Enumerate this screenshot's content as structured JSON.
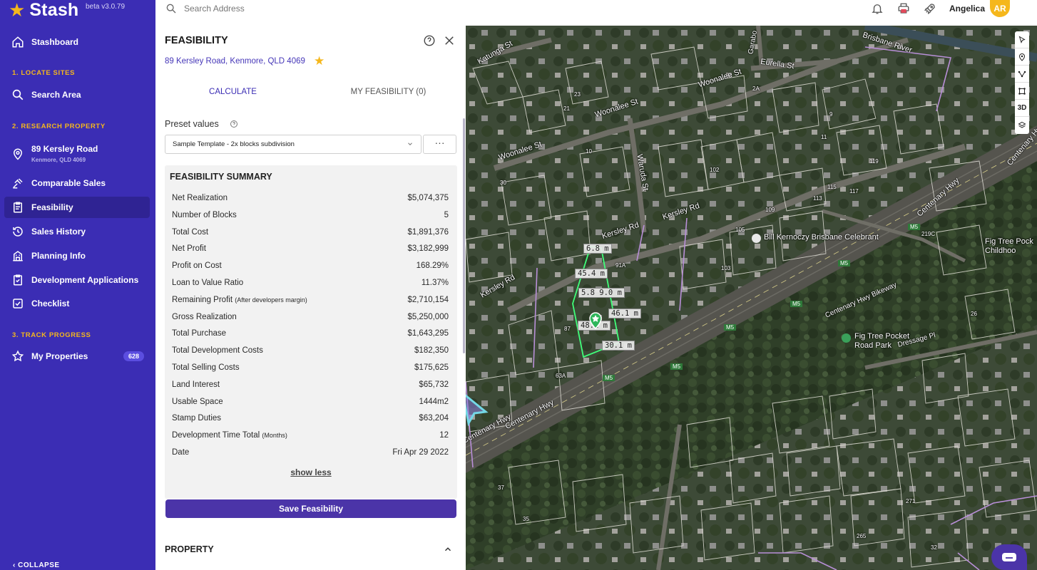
{
  "app": {
    "name": "Stash",
    "version": "beta v3.0.79"
  },
  "sidebar": {
    "items": [
      {
        "label": "Stashboard",
        "icon": "home-icon"
      },
      {
        "label": "Search Area",
        "icon": "search-icon"
      },
      {
        "label": "89 Kersley Road",
        "sublabel": "Kenmore, QLD 4069",
        "icon": "location-pin-icon"
      },
      {
        "label": "Comparable Sales",
        "icon": "gavel-icon"
      },
      {
        "label": "Feasibility",
        "icon": "clipboard-icon",
        "active": true
      },
      {
        "label": "Sales History",
        "icon": "history-icon"
      },
      {
        "label": "Planning Info",
        "icon": "building-icon"
      },
      {
        "label": "Development Applications",
        "icon": "clipboard-check-icon"
      },
      {
        "label": "Checklist",
        "icon": "checkbox-icon"
      },
      {
        "label": "My Properties",
        "icon": "star-outline-icon",
        "badge": "628"
      }
    ],
    "sections": [
      "1. LOCATE SITES",
      "2. RESEARCH PROPERTY",
      "3. TRACK PROGRESS"
    ],
    "collapse_label": "COLLAPSE"
  },
  "topbar": {
    "search_placeholder": "Search Address",
    "user_name": "Angelica",
    "avatar_initials": "AR"
  },
  "panel": {
    "title": "FEASIBILITY",
    "address": "89 Kersley Road, Kenmore, QLD 4069",
    "tabs": [
      "CALCULATE",
      "MY FEASIBILITY (0)"
    ],
    "preset_label": "Preset values",
    "preset_selected": "Sample Template - 2x blocks subdivision",
    "more_label": "···",
    "summary_title": "FEASIBILITY SUMMARY",
    "rows": [
      {
        "label": "Net Realization",
        "note": "",
        "value": "$5,074,375"
      },
      {
        "label": "Number of Blocks",
        "note": "",
        "value": "5"
      },
      {
        "label": "Total Cost",
        "note": "",
        "value": "$1,891,376"
      },
      {
        "label": "Net Profit",
        "note": "",
        "value": "$3,182,999"
      },
      {
        "label": "Profit on Cost",
        "note": "",
        "value": "168.29%"
      },
      {
        "label": "Loan to Value Ratio",
        "note": "",
        "value": "11.37%"
      },
      {
        "label": "Remaining Profit",
        "note": "(After developers margin)",
        "value": "$2,710,154"
      },
      {
        "label": "Gross Realization",
        "note": "",
        "value": "$5,250,000"
      },
      {
        "label": "Total Purchase",
        "note": "",
        "value": "$1,643,295"
      },
      {
        "label": "Total Development Costs",
        "note": "",
        "value": "$182,350"
      },
      {
        "label": "Total Selling Costs",
        "note": "",
        "value": "$175,625"
      },
      {
        "label": "Land Interest",
        "note": "",
        "value": "$65,732"
      },
      {
        "label": "Usable Space",
        "note": "",
        "value": "1444m2"
      },
      {
        "label": "Stamp Duties",
        "note": "",
        "value": "$63,204"
      },
      {
        "label": "Development Time Total",
        "note": "(Months)",
        "value": "12"
      },
      {
        "label": "Date",
        "note": "",
        "value": "Fri Apr 29 2022"
      }
    ],
    "show_less": "show less",
    "save_button": "Save Feasibility",
    "property_section": "PROPERTY"
  },
  "map": {
    "tool_3d": "3D",
    "streets": [
      "Katunga St",
      "Woonalee St",
      "Woonalee St",
      "Woonalee St",
      "Eurella St",
      "Waruda St",
      "Kersley Rd",
      "Kersley Rd",
      "Kersley Rd",
      "Centenary Hwy",
      "Centenary Hwy",
      "Centenary Hwy",
      "Centenary Hwy Bikeway",
      "Dressage Pl",
      "Brisbane River",
      "Garabo"
    ],
    "places": [
      "Bill Kernoczy Brisbane Celebrant",
      "Fig Tree Pocket Road Park",
      "Fig Tree Pock Childhoo"
    ],
    "road_badges": [
      "M5",
      "M5",
      "M5",
      "M5",
      "M5",
      "M5"
    ],
    "measurements": [
      "6.8 m",
      "45.4 m",
      "5.8 9.0 m",
      "46.1 m",
      "48.2 m",
      "30.1 m"
    ],
    "lot_numbers": [
      "2A",
      "9",
      "11",
      "10",
      "21",
      "23",
      "102",
      "105",
      "109",
      "113",
      "115",
      "117",
      "119",
      "103",
      "91A",
      "87",
      "63A",
      "26",
      "30",
      "37",
      "35",
      "32",
      "265",
      "271",
      "219C"
    ]
  }
}
